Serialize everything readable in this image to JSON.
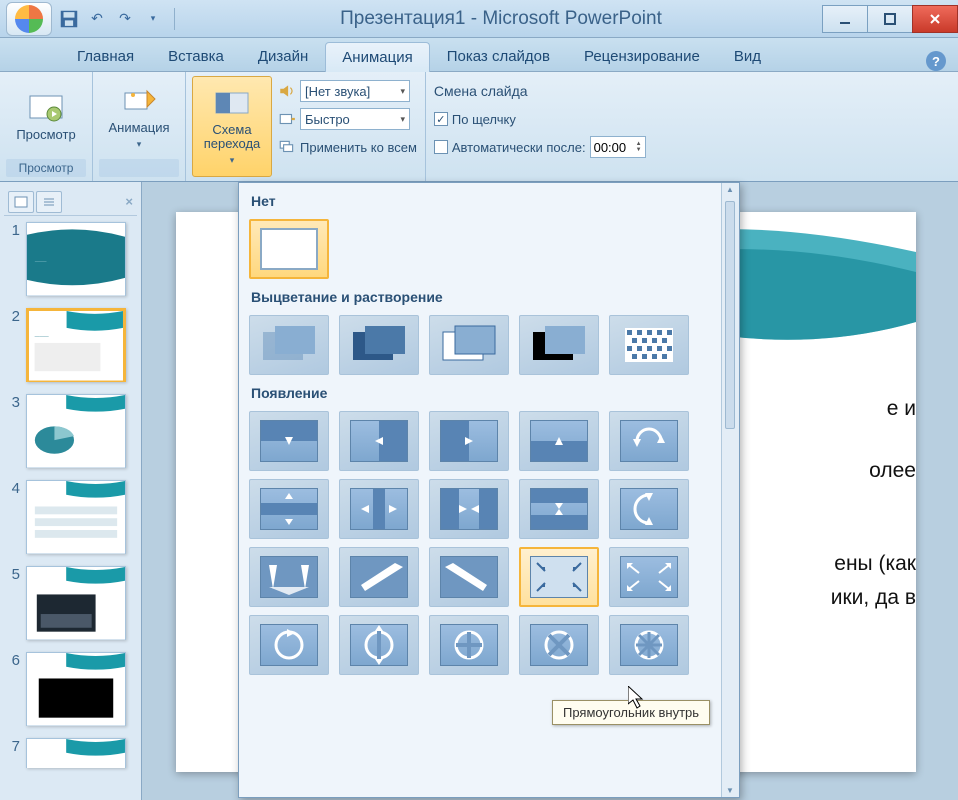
{
  "app": {
    "title": "Презентация1 - Microsoft PowerPoint"
  },
  "tabs": {
    "items": [
      "Главная",
      "Вставка",
      "Дизайн",
      "Анимация",
      "Показ слайдов",
      "Рецензирование",
      "Вид"
    ],
    "active_index": 3
  },
  "ribbon": {
    "preview": {
      "label": "Просмотр",
      "group": "Просмотр"
    },
    "animation": {
      "label": "Анимация"
    },
    "transition": {
      "label": "Схема\nперехода"
    },
    "sound": {
      "value": "[Нет звука]"
    },
    "speed": {
      "value": "Быстро"
    },
    "apply_all": "Применить ко всем",
    "change": {
      "heading": "Смена слайда",
      "on_click": "По щелчку",
      "on_click_checked": true,
      "auto_after": "Автоматически после:",
      "auto_after_checked": false,
      "time": "00:00"
    }
  },
  "gallery": {
    "sections": {
      "none": "Нет",
      "fade": "Выцветание и растворение",
      "appear": "Появление"
    },
    "tooltip": "Прямоугольник внутрь"
  },
  "thumbnails": {
    "count": 7,
    "selected_index": 2,
    "numbers": [
      "1",
      "2",
      "3",
      "4",
      "5",
      "6",
      "7"
    ]
  },
  "slide_body": {
    "line1_frag": "е и",
    "line2_frag": "олее",
    "line3_frag": "ены (как",
    "line4_frag": "ики, да в"
  }
}
